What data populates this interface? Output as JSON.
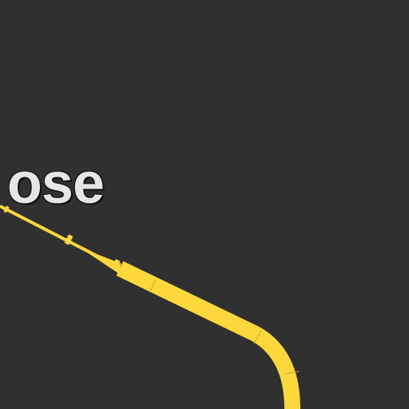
{
  "map": {
    "background_color": "#303030",
    "place_label": "ose",
    "route_color": "#fdd83d",
    "route_outline_color": "#c9a52a"
  }
}
